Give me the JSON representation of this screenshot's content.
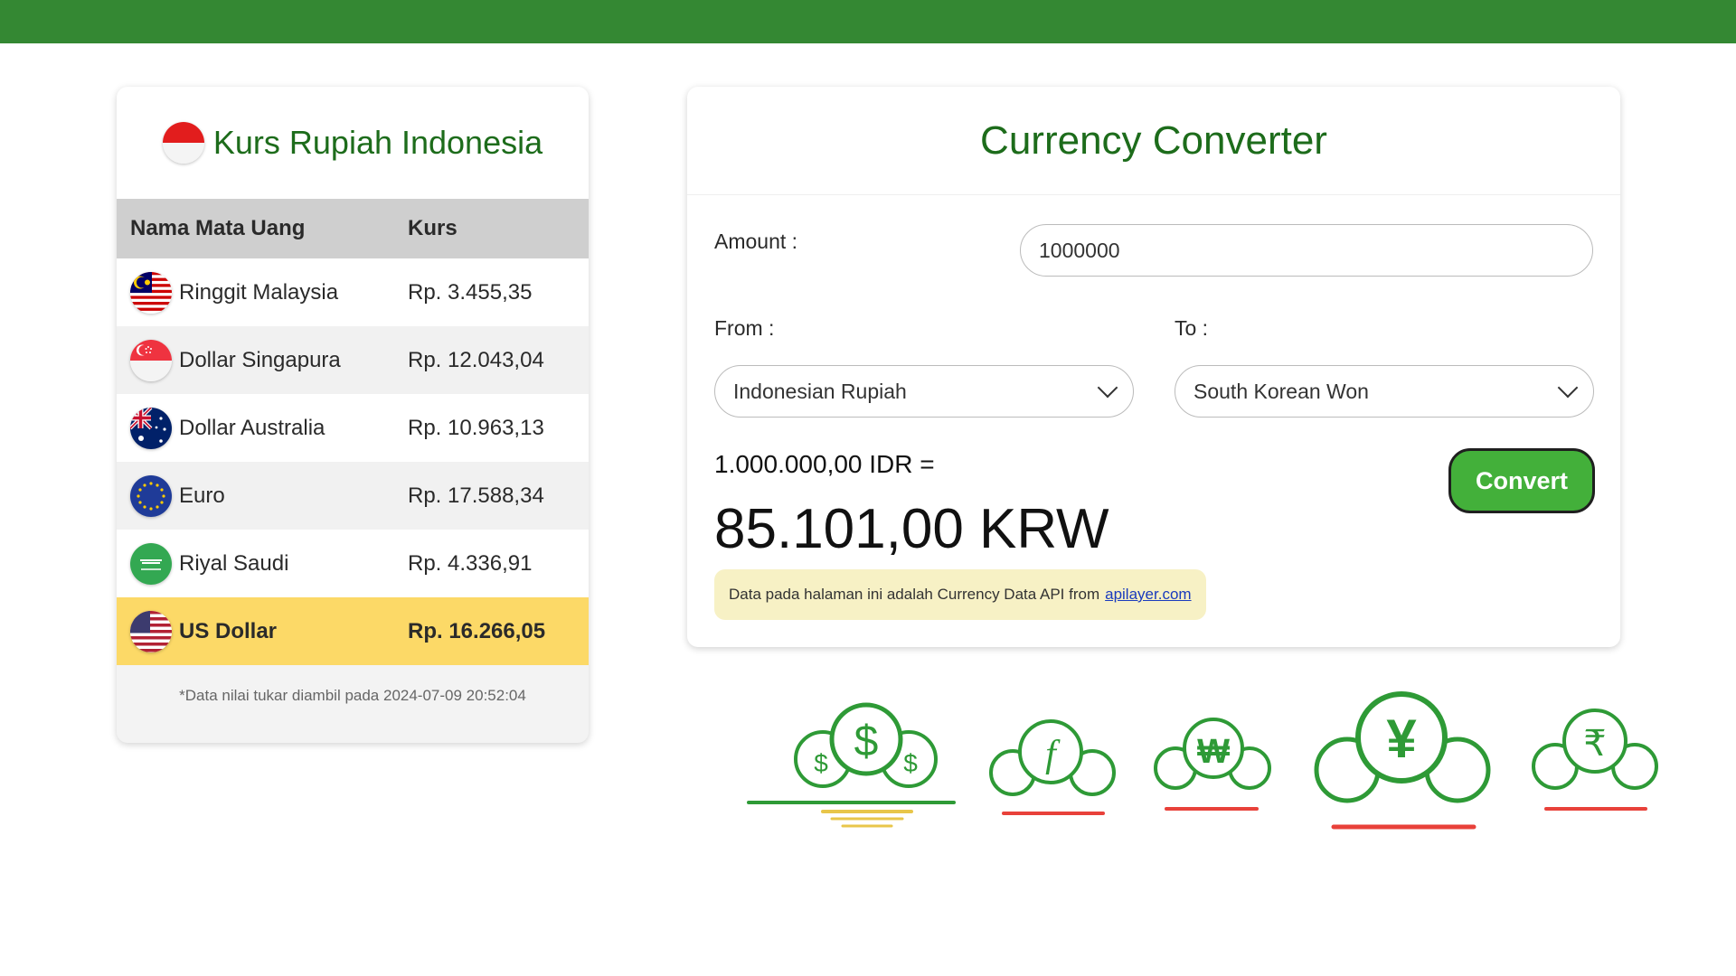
{
  "colors": {
    "brand_green": "#348833",
    "title_green": "#1d6c1b",
    "highlight": "#fcd967",
    "button_green": "#43b03a"
  },
  "rates": {
    "title": "Kurs Rupiah Indonesia",
    "header": {
      "name": "Nama Mata Uang",
      "rate": "Kurs"
    },
    "rows": [
      {
        "flag": "malaysia-flag-icon",
        "name": "Ringgit Malaysia",
        "rate": "Rp. 3.455,35"
      },
      {
        "flag": "singapore-flag-icon",
        "name": "Dollar Singapura",
        "rate": "Rp. 12.043,04"
      },
      {
        "flag": "australia-flag-icon",
        "name": "Dollar Australia",
        "rate": "Rp. 10.963,13"
      },
      {
        "flag": "eu-flag-icon",
        "name": "Euro",
        "rate": "Rp. 17.588,34"
      },
      {
        "flag": "saudi-flag-icon",
        "name": "Riyal Saudi",
        "rate": "Rp. 4.336,91"
      },
      {
        "flag": "usa-flag-icon",
        "name": "US Dollar",
        "rate": "Rp. 16.266,05"
      }
    ],
    "note": "*Data nilai tukar diambil pada 2024-07-09 20:52:04"
  },
  "converter": {
    "title": "Currency Converter",
    "amount_label": "Amount :",
    "amount_value": "1000000",
    "from_label": "From :",
    "from_value": "Indonesian Rupiah",
    "to_label": "To :",
    "to_value": "South Korean Won",
    "convert_label": "Convert",
    "result_line": "1.000.000,00 IDR =",
    "result_value": "85.101,00 KRW",
    "api_note": "Data pada halaman ini adalah Currency Data API from",
    "api_link": "apilayer.com"
  },
  "illustration": {
    "coins": [
      "dollar-coins-icon",
      "florin-coins-icon",
      "won-coins-icon",
      "yen-coins-icon",
      "rupee-coins-icon"
    ]
  }
}
